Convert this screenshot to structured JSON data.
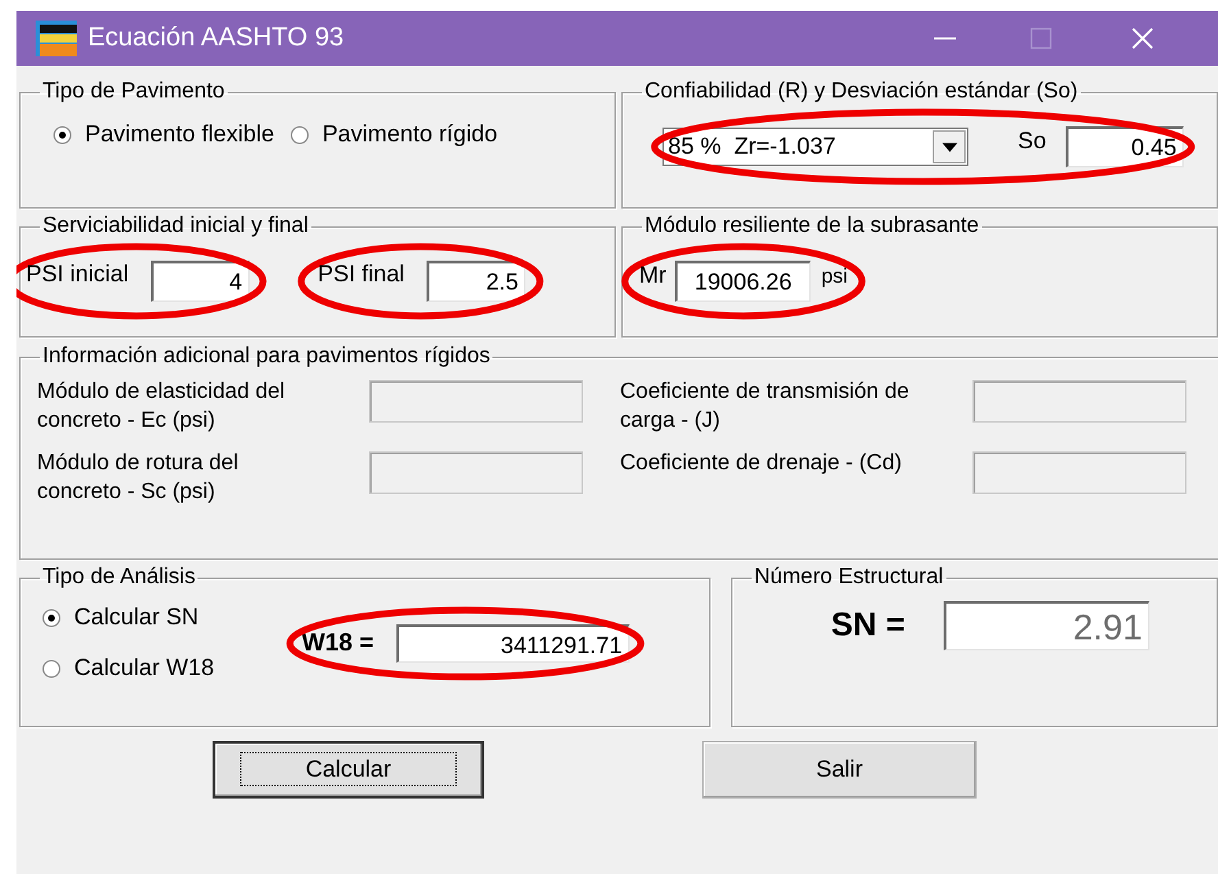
{
  "window": {
    "title": "Ecuación AASHTO 93",
    "maximize_disabled": true
  },
  "pavement_type": {
    "title": "Tipo de Pavimento",
    "options": [
      {
        "label": "Pavimento flexible",
        "selected": true
      },
      {
        "label": "Pavimento rígido",
        "selected": false
      }
    ]
  },
  "reliability": {
    "title": "Confiabilidad (R) y Desviación estándar (So)",
    "dropdown_value": "85 %  Zr=-1.037",
    "so_label": "So",
    "so_value": "0.45",
    "highlighted": true
  },
  "serviceability": {
    "title": "Serviciabilidad inicial y final",
    "fields": [
      {
        "label": "PSI inicial",
        "value": "4",
        "highlighted": true
      },
      {
        "label": "PSI final",
        "value": "2.5",
        "highlighted": true
      }
    ]
  },
  "resilient_modulus": {
    "title": "Módulo resiliente de la subrasante",
    "label": "Mr",
    "value": "19006.26",
    "unit": "psi",
    "highlighted": true
  },
  "rigid_info": {
    "title": "Información adicional para pavimentos rígidos",
    "fields": [
      {
        "label": "Módulo de elasticidad del concreto - Ec (psi)",
        "disabled": true
      },
      {
        "label": "Coeficiente de transmisión de carga - (J)",
        "disabled": true
      },
      {
        "label": "Módulo de rotura del concreto - Sc (psi)",
        "disabled": true
      },
      {
        "label": "Coeficiente de drenaje - (Cd)",
        "disabled": true
      }
    ]
  },
  "analysis": {
    "title": "Tipo de Análisis",
    "options": [
      {
        "label": "Calcular SN",
        "selected": true
      },
      {
        "label": "Calcular W18",
        "selected": false
      }
    ],
    "w18_label": "W18 =",
    "w18_value": "3411291.71",
    "highlighted": true
  },
  "structural_number": {
    "title": "Número Estructural",
    "label": "SN =",
    "value": "2.91"
  },
  "buttons": [
    {
      "label": "Calcular",
      "focused": true
    },
    {
      "label": "Salir",
      "focused": false
    }
  ]
}
